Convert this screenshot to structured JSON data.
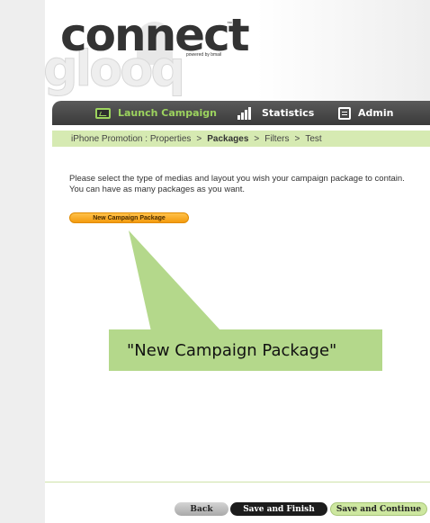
{
  "logo": {
    "connect": "connect",
    "tm": "™",
    "powered": "powered by bmail",
    "gloo": "glooq"
  },
  "nav": {
    "items": [
      {
        "label": "Launch Campaign",
        "icon": "monitor-icon",
        "active": true
      },
      {
        "label": "Statistics",
        "icon": "bar-chart-icon",
        "active": false
      },
      {
        "label": "Admin",
        "icon": "admin-icon",
        "active": false
      }
    ]
  },
  "breadcrumb": {
    "campaign": "iPhone Promotion : Properties",
    "sep1": ">",
    "current": "Packages",
    "sep2": ">",
    "filters": "Filters",
    "sep3": ">",
    "test": "Test"
  },
  "intro_text": "Please select the type of medias and layout you wish your campaign package to contain. You can have as many packages as you want.",
  "new_package_button": "New Campaign Package",
  "annotation": {
    "text": "\"New Campaign Package\"",
    "color": "#b4d88b"
  },
  "footer": {
    "back": "Back",
    "save_finish": "Save and Finish",
    "save_continue": "Save and Continue"
  },
  "colors": {
    "accent_green": "#9cd35e",
    "breadcrumb_bg": "#d6eab2",
    "button_orange": "#f39b0e",
    "nav_dark": "#3a3a3a"
  }
}
